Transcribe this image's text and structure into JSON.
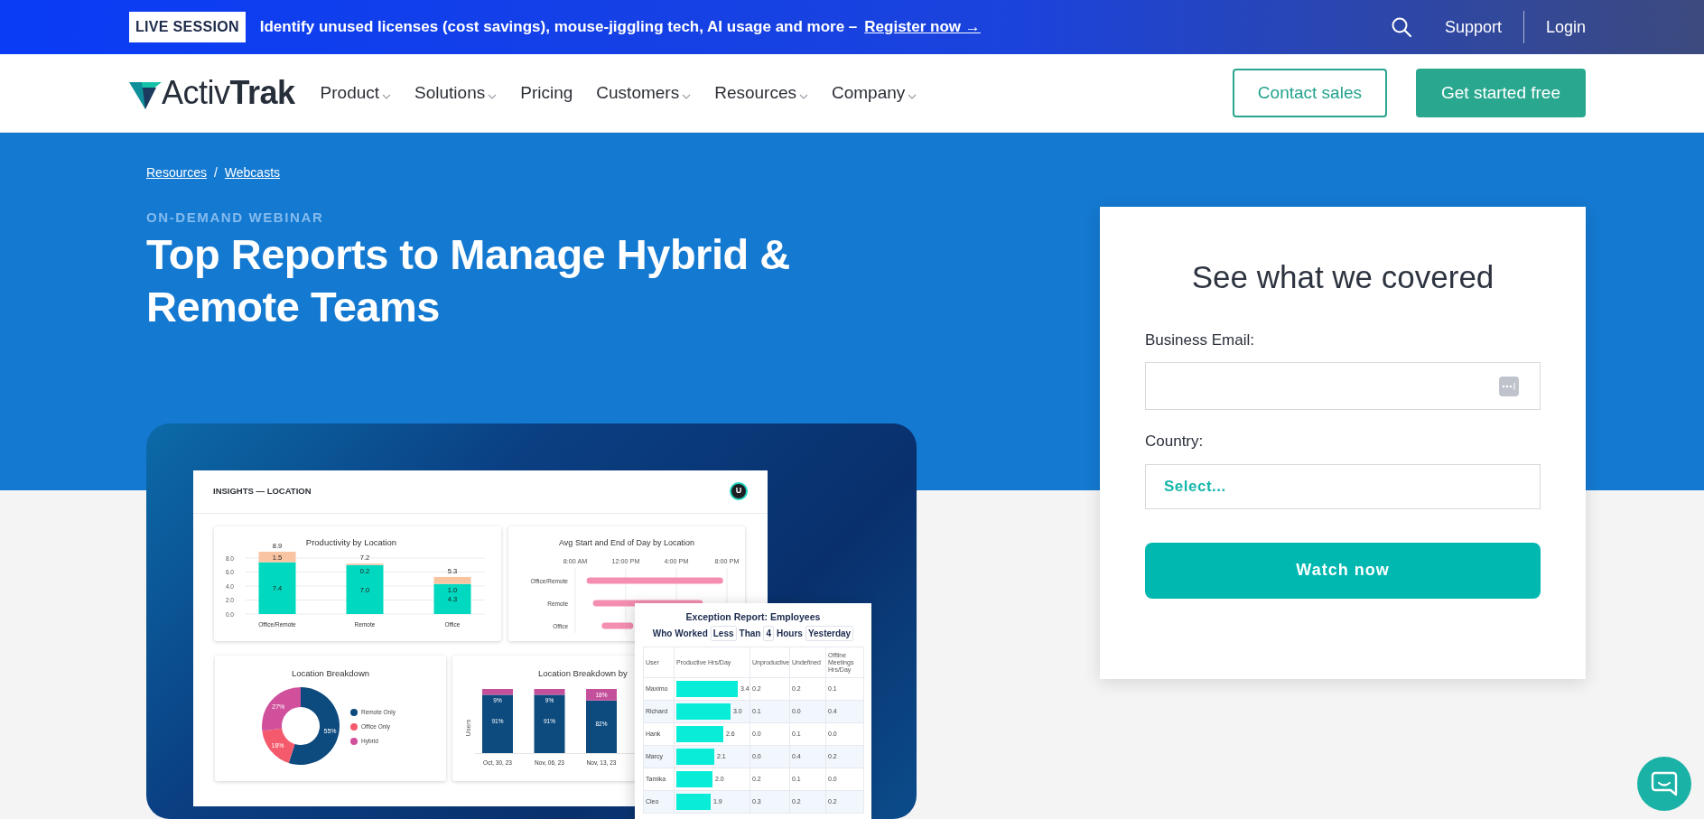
{
  "announcement": {
    "badge": "LIVE SESSION",
    "text": "Identify unused licenses (cost savings), mouse-jiggling tech, AI usage and more –",
    "link": "Register now →"
  },
  "utility_nav": {
    "links": [
      "Support",
      "Login"
    ]
  },
  "navbar": {
    "logo": "Activ**Trak**",
    "items": [
      {
        "label": "Product",
        "dropdown": true
      },
      {
        "label": "Solutions",
        "dropdown": true
      },
      {
        "label": "Pricing",
        "dropdown": false
      },
      {
        "label": "Customers",
        "dropdown": true
      },
      {
        "label": "Resources",
        "dropdown": true
      },
      {
        "label": "Company",
        "dropdown": true
      }
    ],
    "buttons": [
      {
        "label": "Contact sales",
        "kind": "outline"
      },
      {
        "label": "Get started free",
        "kind": "solid"
      }
    ]
  },
  "breadcrumb": {
    "items": [
      "Resources",
      "Webcasts"
    ],
    "separator": "/"
  },
  "eyebrow": "ON-DEMAND WEBINAR",
  "title_lines": [
    "Top Reports to Manage Hybrid &",
    "Remote Teams"
  ],
  "dashboard": {
    "header": "INSIGHTS — LOCATION",
    "avatar": "U",
    "productivity": {
      "chart_data": {
        "type": "bar",
        "title": "Productivity by Location",
        "categories": [
          "Office/Remote",
          "Remote",
          "Office"
        ],
        "stacked": true,
        "grid": true,
        "ylim": [
          0,
          9
        ],
        "series": [
          {
            "color": "#00d9bf",
            "values": [
              7.4,
              7.0,
              4.3
            ],
            "value_labels": [
              "7.4",
              "7.0",
              "4.3"
            ]
          },
          {
            "color": "#f9c4a2",
            "values": [
              1.5,
              0.2,
              1.0
            ],
            "value_labels": [
              "1.5",
              "0.2",
              "1.0"
            ]
          }
        ],
        "yticks": [
          {
            "value": 0,
            "label": "0.0"
          },
          {
            "value": 2,
            "label": "2.0"
          },
          {
            "value": 4,
            "label": "4.0"
          },
          {
            "value": 6,
            "label": "6.0"
          },
          {
            "value": 8,
            "label": "8.0"
          }
        ],
        "annotations": [
          {
            "x": "Office/Remote",
            "y": 8.9,
            "text": "8.9"
          },
          {
            "x": "Remote",
            "y": 7.2,
            "text": "7.2"
          },
          {
            "x": "Office",
            "y": 5.3,
            "text": "5.3"
          }
        ]
      }
    },
    "day_span": {
      "chart_data": {
        "type": "bar",
        "orientation": "horizontal",
        "title": "Avg Start and End of Day by Location",
        "categories": [
          "Office/Remote",
          "Remote",
          "Office"
        ],
        "grid": true,
        "xlim": [
          8,
          20
        ],
        "series": [
          {
            "color": "#f58fb2",
            "base": [
              8.9,
              9.4,
              10.1
            ],
            "values": [
              10.8,
              8.7,
              2.5
            ]
          }
        ],
        "xticks": [
          {
            "value": 8,
            "label": "8:00 AM"
          },
          {
            "value": 12,
            "label": "12:00 PM"
          },
          {
            "value": 16,
            "label": "4:00 PM"
          },
          {
            "value": 20,
            "label": "8:00 PM"
          }
        ]
      }
    },
    "breakdown": {
      "chart_data": {
        "type": "donut",
        "title": "Location Breakdown",
        "categories": [
          "Remote Only",
          "Office Only",
          "Hybrid"
        ],
        "values": [
          55,
          18,
          27
        ],
        "colors": [
          "#0d4a7e",
          "#f55a6c",
          "#d0509c"
        ],
        "value_labels": [
          "55%",
          "18%",
          "27%"
        ],
        "legend": true
      }
    },
    "breakdown_by_week": {
      "chart_data": {
        "type": "bar",
        "title": "Location Breakdown by",
        "ylabel": "Users",
        "categories": [
          "Oct, 30, 23",
          "Nov, 06, 23",
          "Nov, 13, 23"
        ],
        "stacked": true,
        "series": [
          {
            "color": "#0d4a7e",
            "values": [
              91,
              91,
              82
            ],
            "value_labels": [
              "91%",
              "91%",
              "82%"
            ]
          },
          {
            "color": "#c4509c",
            "values": [
              9,
              9,
              18
            ],
            "value_labels": [
              "9%",
              "9%",
              "18%"
            ]
          }
        ]
      }
    },
    "exception_report": {
      "title": "Exception Report: Employees",
      "filter": [
        {
          "text": "Who Worked",
          "kind": "text"
        },
        {
          "text": "Less",
          "kind": "select"
        },
        {
          "text": "Than",
          "kind": "text"
        },
        {
          "text": "4",
          "kind": "select"
        },
        {
          "text": "Hours",
          "kind": "text"
        },
        {
          "text": "Yesterday",
          "kind": "select"
        }
      ],
      "columns": [
        "User",
        "Productive Hrs/Day",
        "Unproductive",
        "Undefined",
        "Offline Meetings Hrs/Day"
      ],
      "rows": [
        {
          "user": "Maximo",
          "productive": "3.4",
          "level": 0.85,
          "unproductive": "0.2",
          "undefined": "0.2",
          "offline": "0.1"
        },
        {
          "user": "Richard",
          "productive": "3.0",
          "level": 0.75,
          "unproductive": "0.1",
          "undefined": "0.0",
          "offline": "0.4"
        },
        {
          "user": "Hank",
          "productive": "2.6",
          "level": 0.65,
          "unproductive": "0.0",
          "undefined": "0.1",
          "offline": "0.0"
        },
        {
          "user": "Marcy",
          "productive": "2.1",
          "level": 0.525,
          "unproductive": "0.0",
          "undefined": "0.4",
          "offline": "0.2"
        },
        {
          "user": "Tamika",
          "productive": "2.0",
          "level": 0.5,
          "unproductive": "0.2",
          "undefined": "0.1",
          "offline": "0.0"
        },
        {
          "user": "Cleo",
          "productive": "1.9",
          "level": 0.475,
          "unproductive": "0.3",
          "undefined": "0.2",
          "offline": "0.2"
        }
      ]
    }
  },
  "form": {
    "title": "See what we covered",
    "fields": [
      {
        "label": "Business Email:",
        "kind": "text"
      },
      {
        "label": "Country:",
        "kind": "select",
        "value": "Select..."
      }
    ],
    "submit": "Watch now"
  }
}
